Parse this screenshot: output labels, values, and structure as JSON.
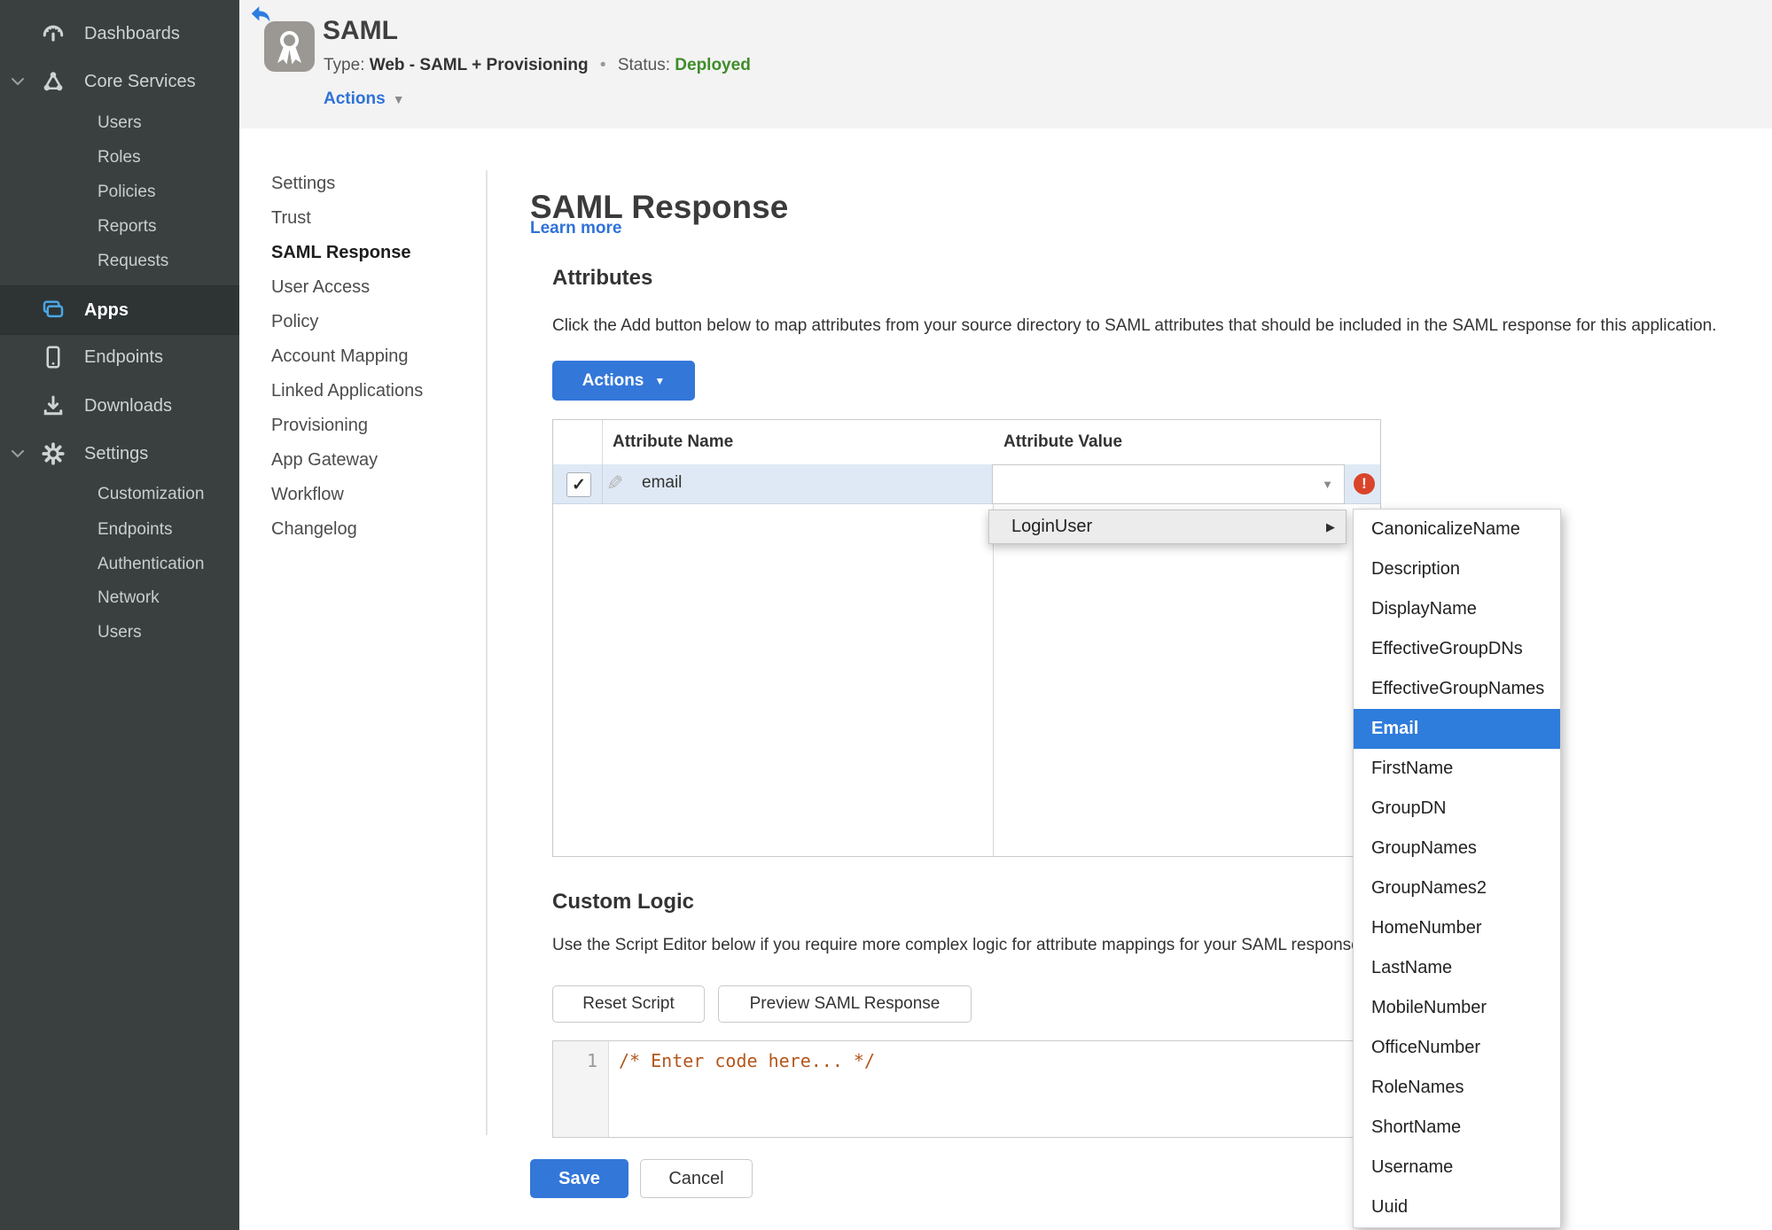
{
  "colors": {
    "accent_blue": "#3377d9",
    "menu_selected_blue": "#2e7cdb",
    "status_green": "#3f8c2a",
    "error_red": "#d9442a",
    "sidebar_bg": "#3a4040",
    "sidebar_active_bg": "#2e3434",
    "row_selected_blue": "#dfe9f5",
    "code_comment_orange": "#b4571c",
    "apps_icon_blue": "#49a8e8"
  },
  "icons": {
    "check": "✓",
    "pencil": "✎",
    "caret_down": "▼",
    "caret_right": "▶",
    "error": "!",
    "separator_dot": "•"
  },
  "sidebar": {
    "items": [
      {
        "label": "Dashboards"
      },
      {
        "label": "Core Services"
      },
      {
        "label": "Users"
      },
      {
        "label": "Roles"
      },
      {
        "label": "Policies"
      },
      {
        "label": "Reports"
      },
      {
        "label": "Requests"
      },
      {
        "label": "Apps"
      },
      {
        "label": "Endpoints"
      },
      {
        "label": "Downloads"
      },
      {
        "label": "Settings"
      },
      {
        "label": "Customization"
      },
      {
        "label": "Endpoints"
      },
      {
        "label": "Authentication"
      },
      {
        "label": "Network"
      },
      {
        "label": "Users"
      }
    ]
  },
  "header": {
    "title": "SAML",
    "type_label": "Type:",
    "type_value": "Web - SAML + Provisioning",
    "status_label": "Status:",
    "status_value": "Deployed",
    "actions_label": "Actions"
  },
  "subnav": {
    "items": [
      "Settings",
      "Trust",
      "SAML Response",
      "User Access",
      "Policy",
      "Account Mapping",
      "Linked Applications",
      "Provisioning",
      "App Gateway",
      "Workflow",
      "Changelog"
    ],
    "active": "SAML Response"
  },
  "main": {
    "title": "SAML Response",
    "learn_more": "Learn more",
    "attributes": {
      "heading": "Attributes",
      "description": "Click the Add button below to map attributes from your source directory to SAML attributes that should be included in the SAML response for this application.",
      "actions_button": "Actions",
      "table": {
        "columns": [
          "Attribute Name",
          "Attribute Value"
        ],
        "rows": [
          {
            "name": "email",
            "value": "",
            "checked": true,
            "error": true
          }
        ]
      }
    },
    "custom_logic": {
      "heading": "Custom Logic",
      "description": "Use the Script Editor below if you require more complex logic for attribute mappings for your SAML response.",
      "reset_button": "Reset Script",
      "preview_button": "Preview SAML Response",
      "editor": {
        "line_number": "1",
        "code": "/* Enter code here... */"
      }
    },
    "save_button": "Save",
    "cancel_button": "Cancel"
  },
  "menus": {
    "value_menu": {
      "label": "LoginUser"
    },
    "attribute_submenu": {
      "selected": "Email",
      "items": [
        "CanonicalizeName",
        "Description",
        "DisplayName",
        "EffectiveGroupDNs",
        "EffectiveGroupNames",
        "Email",
        "FirstName",
        "GroupDN",
        "GroupNames",
        "GroupNames2",
        "HomeNumber",
        "LastName",
        "MobileNumber",
        "OfficeNumber",
        "RoleNames",
        "ShortName",
        "Username",
        "Uuid"
      ]
    }
  }
}
